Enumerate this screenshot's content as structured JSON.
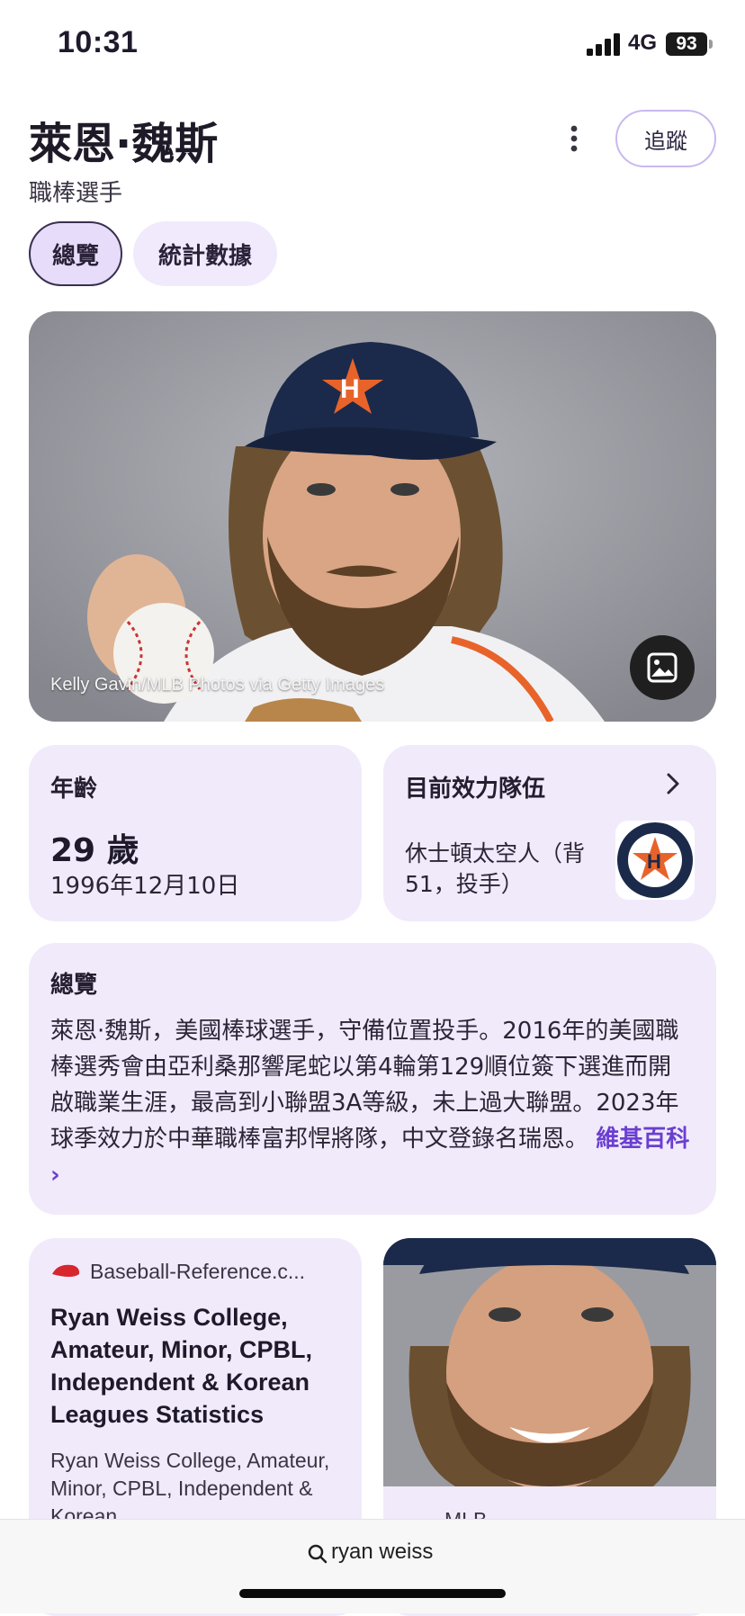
{
  "status_bar": {
    "time": "10:31",
    "network": "4G",
    "battery": "93"
  },
  "header": {
    "name": "萊恩·魏斯",
    "subtitle": "職棒選手",
    "follow_label": "追蹤"
  },
  "tabs": [
    {
      "label": "總覽",
      "selected": true
    },
    {
      "label": "統計數據",
      "selected": false
    }
  ],
  "hero": {
    "credit": "Kelly Gavin/MLB Photos via Getty Images"
  },
  "age_card": {
    "label": "年齡",
    "value": "29 歲",
    "birthdate": "1996年12月10日"
  },
  "team_card": {
    "label": "目前效力隊伍",
    "description": "休士頓太空人（背51，投手）"
  },
  "overview": {
    "label": "總覽",
    "text": "萊恩·魏斯，美國棒球選手，守備位置投手。2016年的美國職棒選秀會由亞利桑那響尾蛇以第4輪第129順位簽下選進而開啟職業生涯，最高到小聯盟3A等級，未上過大聯盟。2023年球季效力於中華職棒富邦悍將隊，中文登錄名瑞恩。",
    "link": "維基百科 ›"
  },
  "result_cards": [
    {
      "source": "Baseball-Reference.c...",
      "title": "Ryan Weiss College, Amateur, Minor, CPBL, Independent & Korean Leagues Statistics",
      "snippet": "Ryan Weiss College, Amateur, Minor, CPBL, Independent & Korean"
    },
    {
      "source": "MLB"
    }
  ],
  "search": {
    "query": "ryan weiss"
  },
  "colors": {
    "accent": "#6a3fd0",
    "card_bg": "#f1eafb",
    "tab_selected_bg": "#e7ddfa"
  }
}
